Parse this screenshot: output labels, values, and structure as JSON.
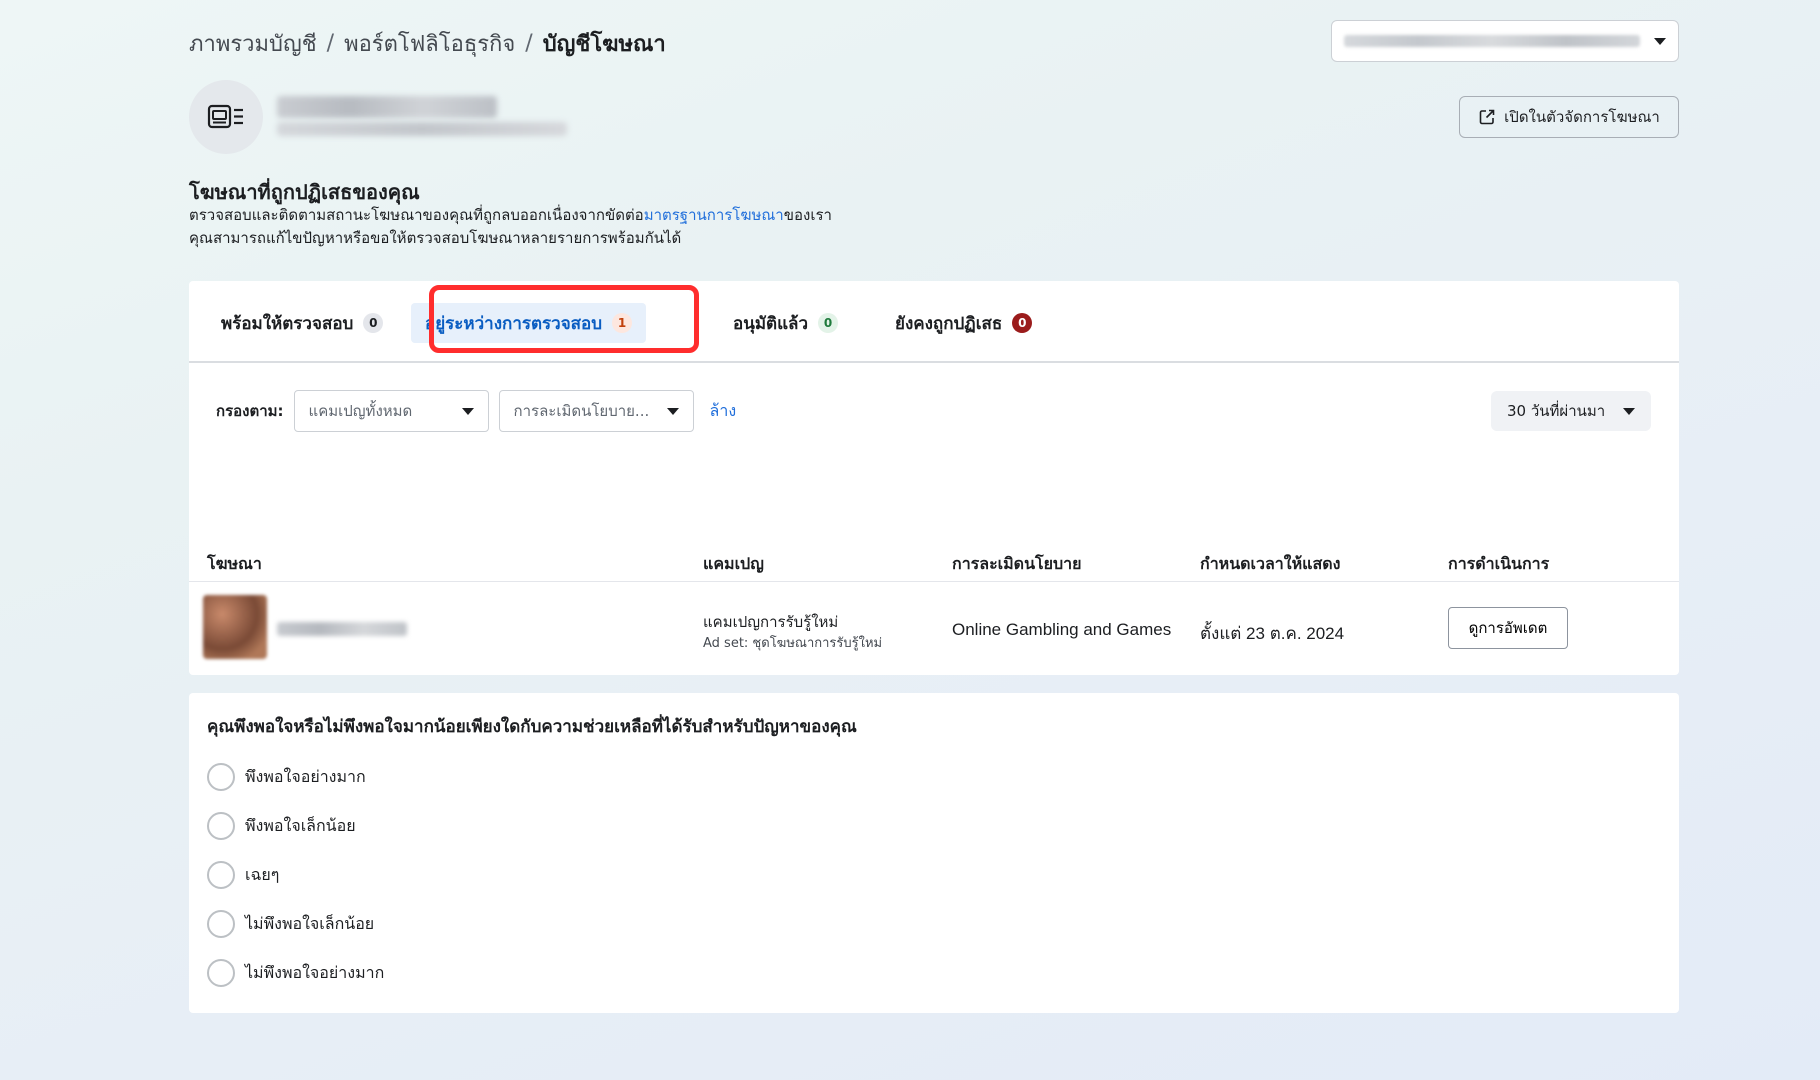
{
  "breadcrumb": {
    "items": [
      "ภาพรวมบัญชี",
      "พอร์ตโฟลิโอธุรกิจ",
      "บัญชีโฆษณา"
    ],
    "separator": "/"
  },
  "header": {
    "open_button_label": "เปิดในตัวจัดการโฆษณา"
  },
  "section": {
    "title": "โฆษณาที่ถูกปฏิเสธของคุณ",
    "desc_line1_before": "ตรวจสอบและติดตามสถานะโฆษณาของคุณที่ถูกลบออกเนื่องจากขัดต่อ",
    "desc_link": "มาตรฐานการโฆษณา",
    "desc_line1_after": "ของเรา",
    "desc_line2": "คุณสามารถแก้ไขปัญหาหรือขอให้ตรวจสอบโฆษณาหลายรายการพร้อมกันได้"
  },
  "tabs": [
    {
      "label": "พร้อมให้ตรวจสอบ",
      "count": "0"
    },
    {
      "label": "อยู่ระหว่างการตรวจสอบ",
      "count": "1"
    },
    {
      "label": "อนุมัติแล้ว",
      "count": "0"
    },
    {
      "label": "ยังคงถูกปฏิเสธ",
      "count": "0"
    }
  ],
  "active_tab": 1,
  "filters": {
    "label": "กรองตาม:",
    "campaign_value": "แคมเปญทั้งหมด",
    "policy_value": "การละเมิดนโยบาย...",
    "clear_label": "ล้าง",
    "date_value": "30 วันที่ผ่านมา"
  },
  "table": {
    "columns": [
      "โฆษณา",
      "แคมเปญ",
      "การละเมิดนโยบาย",
      "กำหนดเวลาให้แสดง",
      "การดำเนินการ"
    ],
    "rows": [
      {
        "campaign": "แคมเปญการรับรู้ใหม่",
        "ad_set": "Ad set: ชุดโฆษณาการรับรู้ใหม่",
        "violation": "Online Gambling and Games",
        "schedule": "ตั้งแต่ 23 ต.ค. 2024",
        "action_label": "ดูการอัพเดต"
      }
    ]
  },
  "survey": {
    "question": "คุณพึงพอใจหรือไม่พึงพอใจมากน้อยเพียงใดกับความช่วยเหลือที่ได้รับสำหรับปัญหาของคุณ",
    "options": [
      "พึงพอใจอย่างมาก",
      "พึงพอใจเล็กน้อย",
      "เฉยๆ",
      "ไม่พึงพอใจเล็กน้อย",
      "ไม่พึงพอใจอย่างมาก"
    ]
  },
  "colors": {
    "accent": "#216fdb",
    "active_tab_bg": "#e7f0fb",
    "highlight_box": "#ff2d2d",
    "rejected_badge": "#9b1c1c"
  }
}
